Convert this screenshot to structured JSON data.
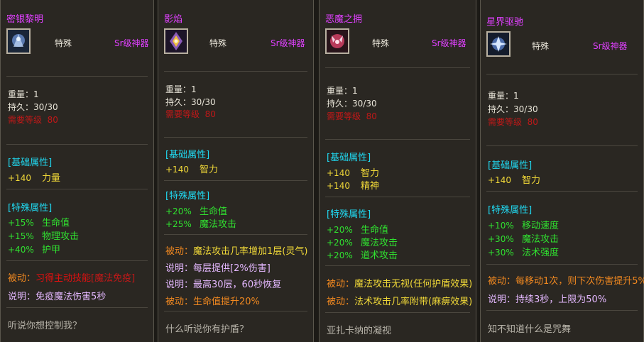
{
  "labels": {
    "weight": "重量：",
    "durability": "持久：",
    "req_level": "需要等级",
    "basic_section": "[基础属性]",
    "special_section": "[特殊属性]"
  },
  "cards": [
    {
      "name": "密银黎明",
      "type": "特殊",
      "grade": "Sr级神器",
      "weight": "1",
      "durability": "30/30",
      "req_level": "80",
      "basic": [
        {
          "val": "+140",
          "stat": "力量"
        }
      ],
      "special": [
        {
          "val": "+15%",
          "stat": "生命值"
        },
        {
          "val": "+15%",
          "stat": "物理攻击"
        },
        {
          "val": "+40%",
          "stat": "护甲"
        }
      ],
      "passive_label": "被动：",
      "passive_text": "习得主动技能",
      "passive_skill": "[魔法免疫]",
      "notes": [
        {
          "label": "说明：",
          "text": "免疫魔法伤害5秒"
        }
      ],
      "flavor": "听说你想控制我？",
      "icon": "silver-dawn-icon",
      "icon_color": "#5a7ab0"
    },
    {
      "name": "影焰",
      "type": "特殊",
      "grade": "Sr级神器",
      "weight": "1",
      "durability": "30/30",
      "req_level": "80",
      "basic": [
        {
          "val": "+140",
          "stat": "智力"
        }
      ],
      "special": [
        {
          "val": "+20%",
          "stat": "生命值"
        },
        {
          "val": "+25%",
          "stat": "魔法攻击"
        }
      ],
      "passive_label": "被动：",
      "passive_text": "魔法攻击几率增加1层(灵气)",
      "notes": [
        {
          "label": "说明：",
          "text": "每层提供[2%伤害]"
        },
        {
          "label": "说明：",
          "text": "最高30层，60秒恢复"
        },
        {
          "label": "被动：",
          "text": "生命值提升20%"
        }
      ],
      "flavor": "什么听说你有护盾？",
      "icon": "shadowflame-icon",
      "icon_color": "#8a5ab8"
    },
    {
      "name": "恶魔之拥",
      "type": "特殊",
      "grade": "Sr级神器",
      "weight": "1",
      "durability": "30/30",
      "req_level": "80",
      "basic": [
        {
          "val": "+140",
          "stat": "智力"
        },
        {
          "val": "+140",
          "stat": "精神"
        }
      ],
      "special": [
        {
          "val": "+20%",
          "stat": "生命值"
        },
        {
          "val": "+20%",
          "stat": "魔法攻击"
        },
        {
          "val": "+20%",
          "stat": "道术攻击"
        }
      ],
      "passive_label": "被动：",
      "passive_text": "魔法攻击无视(任何护盾效果)",
      "notes": [
        {
          "label": "被动：",
          "text": "法术攻击几率附带(麻痹效果)"
        }
      ],
      "flavor": "亚扎卡纳的凝视",
      "icon": "demon-embrace-icon",
      "icon_color": "#b83a5a"
    },
    {
      "name": "星界驱驰",
      "type": "特殊",
      "grade": "Sr级神器",
      "weight": "1",
      "durability": "30/30",
      "req_level": "80",
      "basic": [
        {
          "val": "+140",
          "stat": "智力"
        }
      ],
      "special": [
        {
          "val": "+10%",
          "stat": "移动速度"
        },
        {
          "val": "+30%",
          "stat": "魔法攻击"
        },
        {
          "val": "+30%",
          "stat": "法术强度"
        }
      ],
      "passive_label": "被动：",
      "passive_text": "每移动1次，则下次伤害提升5%",
      "notes": [
        {
          "label": "说明：",
          "text": "持续3秒，上限为50%"
        }
      ],
      "flavor": "知不知道什么是咒舞",
      "icon": "astral-drive-icon",
      "icon_color": "#4a6aa8"
    }
  ]
}
